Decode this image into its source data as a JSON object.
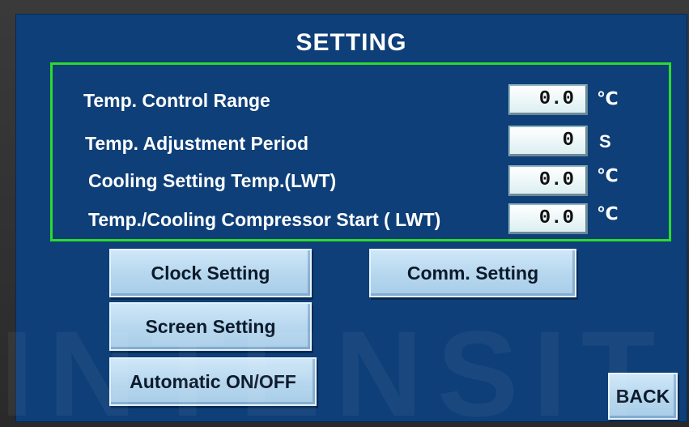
{
  "screen": {
    "title": "SETTING"
  },
  "params": [
    {
      "label": "Temp. Control Range",
      "value": "0.0",
      "unit": "℃"
    },
    {
      "label": "Temp. Adjustment Period",
      "value": "0",
      "unit": "S"
    },
    {
      "label": "Cooling Setting Temp.(LWT)",
      "value": "0.0",
      "unit": "℃"
    },
    {
      "label": "Temp./Cooling Compressor Start ( LWT)",
      "value": "0.0",
      "unit": "℃"
    }
  ],
  "buttons": {
    "clock_setting": "Clock Setting",
    "comm_setting": "Comm. Setting",
    "screen_setting": "Screen Setting",
    "automatic_on_off": "Automatic ON/OFF",
    "back": "BACK"
  },
  "watermark": "INTENSIT",
  "colors": {
    "screen_bg": "#0e3f78",
    "panel_border": "#2bdc2b",
    "button_face": "#b5d6ee",
    "text": "#ffffff"
  }
}
